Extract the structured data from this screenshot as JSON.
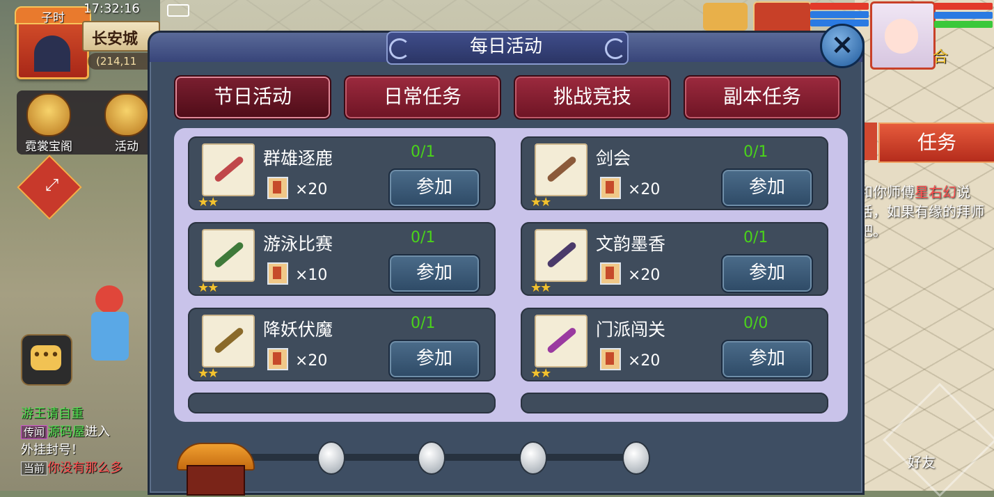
{
  "hud": {
    "time": "17:32:16",
    "shichen": "子时",
    "location": "长安城",
    "coords": "(214,11",
    "buttons": [
      {
        "label": "霓裳宝阁",
        "icon": "gift-icon"
      },
      {
        "label": "活动",
        "icon": "activity-icon"
      }
    ],
    "expand_icon": "expand-arrows-icon"
  },
  "chat": {
    "lines": [
      {
        "channel": "",
        "name": "",
        "text": "游王请自重"
      },
      {
        "channel": "传闻",
        "name": "源码屋",
        "text": "进入"
      },
      {
        "channel": "",
        "name": "",
        "text": "外挂封号！"
      },
      {
        "channel": "当前",
        "name": "",
        "text": "你没有那么多"
      }
    ]
  },
  "right_hud": {
    "task_tab": "任务",
    "task_text_1": "和你师傅",
    "task_text_name": "星右幻",
    "task_text_2": "说话，如果有缘的拜师吧。",
    "watermark_label": "好友",
    "side_char": "合"
  },
  "dialog": {
    "title": "每日活动",
    "close_icon": "close-x-icon",
    "tabs": [
      "节日活动",
      "日常任务",
      "挑战竞技",
      "副本任务"
    ],
    "active_tab": 0,
    "join_label": "参加",
    "activities": [
      {
        "name": "群雄逐鹿",
        "progress": "0/1",
        "reward": "×20",
        "stars": 2,
        "item_color": "#c0474a",
        "icon": "rifle-icon"
      },
      {
        "name": "剑会",
        "progress": "0/1",
        "reward": "×20",
        "stars": 2,
        "item_color": "#8b5a3a",
        "icon": "sword-icon"
      },
      {
        "name": "游泳比赛",
        "progress": "0/1",
        "reward": "×10",
        "stars": 2,
        "item_color": "#3f7a3a",
        "icon": "medallion-icon"
      },
      {
        "name": "文韵墨香",
        "progress": "0/1",
        "reward": "×20",
        "stars": 2,
        "item_color": "#4a3a6a",
        "icon": "dagger-icon"
      },
      {
        "name": "降妖伏魔",
        "progress": "0/1",
        "reward": "×20",
        "stars": 2,
        "item_color": "#8a6a2a",
        "icon": "broom-icon"
      },
      {
        "name": "门派闯关",
        "progress": "0/0",
        "reward": "×20",
        "stars": 2,
        "item_color": "#9a3aa0",
        "icon": "gun-icon"
      }
    ]
  }
}
